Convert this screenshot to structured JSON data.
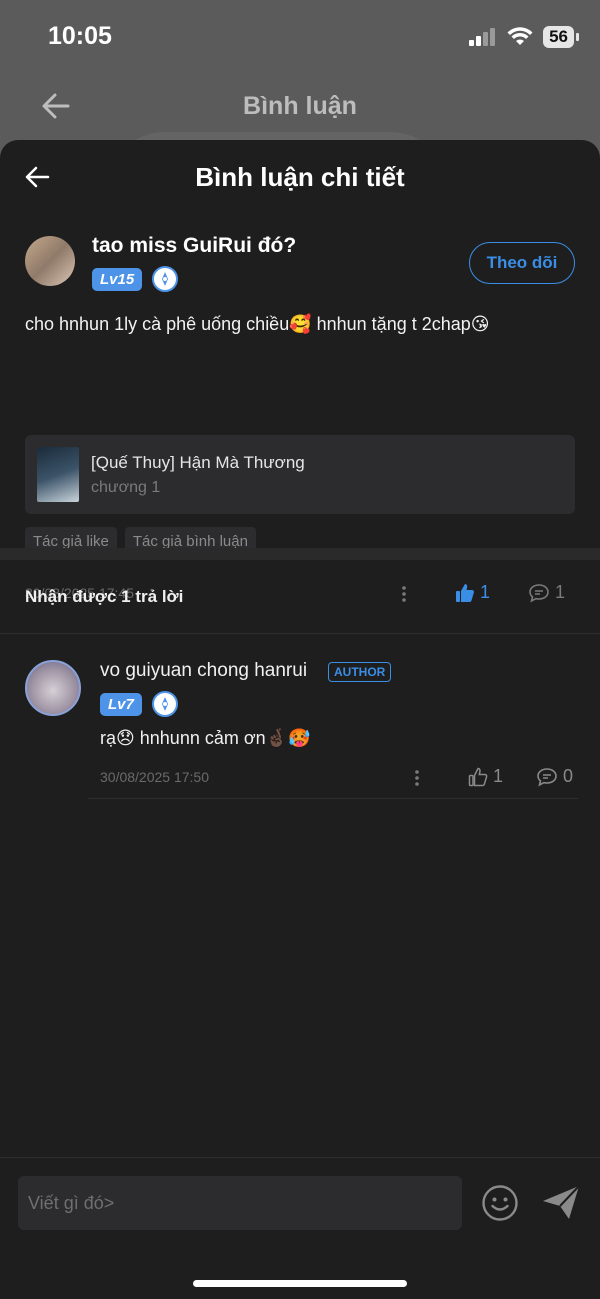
{
  "status_bar": {
    "time": "10:05",
    "battery": "56"
  },
  "behind": {
    "title": "Bình luận"
  },
  "header": {
    "title": "Bình luận chi tiết"
  },
  "comment": {
    "username": "tao miss GuiRui đó?",
    "level": "Lv15",
    "follow_label": "Theo dõi",
    "text": "cho hnhun 1ly cà phê uống chiều🥰 hnhun tặng t 2chap😘",
    "book": {
      "title": "[Quế Thuy] Hận Mà Thương",
      "chapter": "chương 1"
    },
    "tags": [
      "Tác giả like",
      "Tác giả bình luận"
    ],
    "date": "30/08/2025 17:45",
    "likes": "1",
    "replies": "1"
  },
  "replies_header": "Nhận được 1 trả lời",
  "reply": {
    "username": "vo guiyuan chong hanrui",
    "author_badge": "AUTHOR",
    "level": "Lv7",
    "text": "rạ😞 hnhunn cảm ơn🤞🏿🥵",
    "date": "30/08/2025 17:50",
    "likes": "1",
    "replies": "0"
  },
  "input": {
    "placeholder": "Viết gì đó>"
  },
  "colors": {
    "accent": "#3a8ee6",
    "level_badge": "#4d93e8",
    "background": "#1e1e1e"
  },
  "icons": [
    "back-arrow-icon",
    "wifi-icon",
    "signal-icon",
    "thumbs-up-icon",
    "comment-icon",
    "more-dots-icon",
    "emoji-icon",
    "send-icon",
    "medal-icon"
  ]
}
